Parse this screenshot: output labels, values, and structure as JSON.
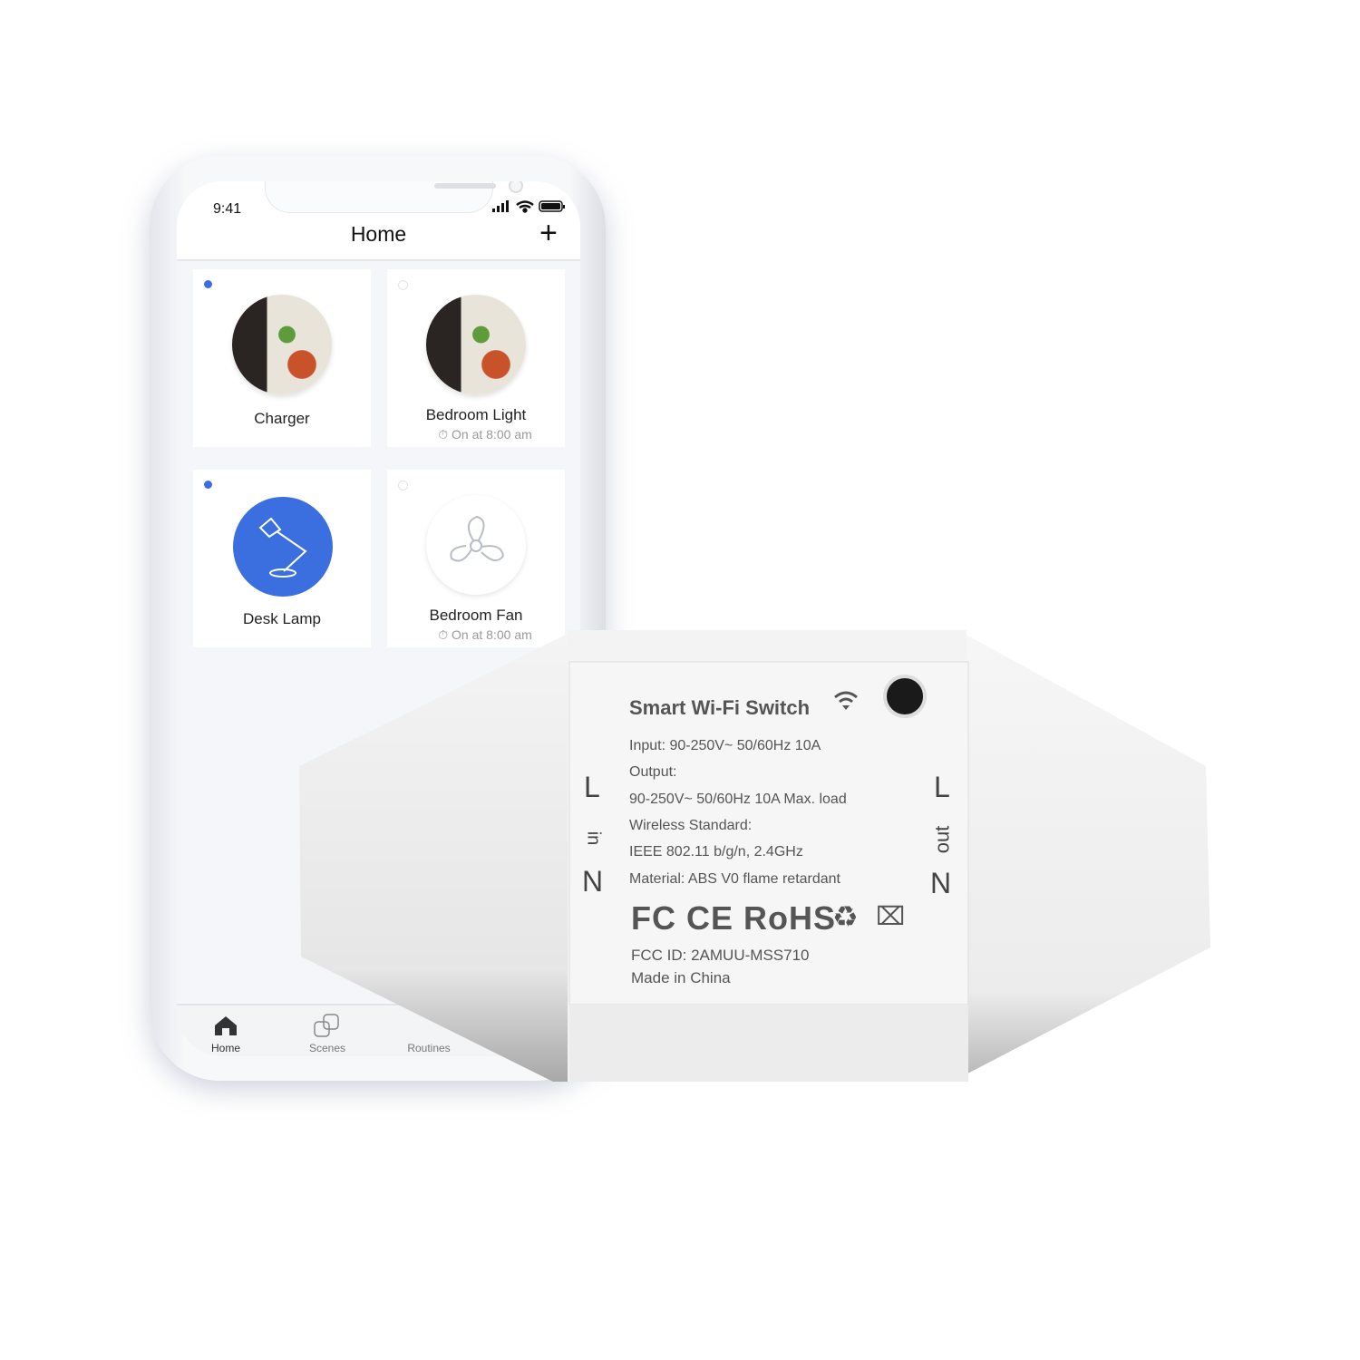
{
  "status_bar": {
    "time": "9:41"
  },
  "header": {
    "title": "Home",
    "add_icon": "plus-icon"
  },
  "devices": [
    {
      "name": "Charger",
      "on": true,
      "icon": "room-photo"
    },
    {
      "name": "Bedroom Light",
      "on": false,
      "icon": "room-photo",
      "schedule": "On at 8:00 am"
    },
    {
      "name": "Desk Lamp",
      "on": true,
      "icon": "desk-lamp-icon"
    },
    {
      "name": "Bedroom Fan",
      "on": false,
      "icon": "fan-icon",
      "schedule": "On at 8:00 am"
    }
  ],
  "tabbar": {
    "tabs": [
      {
        "label": "Home",
        "icon": "home-icon",
        "active": true
      },
      {
        "label": "Scenes",
        "icon": "scenes-icon"
      },
      {
        "label": "Routines",
        "icon": "routines-icon"
      }
    ]
  },
  "colors": {
    "accent": "#3b6fe0"
  },
  "product": {
    "title": "Smart Wi-Fi Switch",
    "lines": [
      "Input: 90-250V~ 50/60Hz 10A",
      "Output:",
      "90-250V~ 50/60Hz 10A Max. load",
      "Wireless Standard:",
      "IEEE 802.11 b/g/n, 2.4GHz",
      "Material: ABS V0 flame retardant"
    ],
    "certs": "FC CE RoHS",
    "fcc_id": "FCC ID: 2AMUU-MSS710",
    "origin": "Made in China",
    "in_label": {
      "l": "L",
      "in": "in",
      "n": "N"
    },
    "out_label": {
      "l": "L",
      "out": "out",
      "n": "N"
    }
  }
}
